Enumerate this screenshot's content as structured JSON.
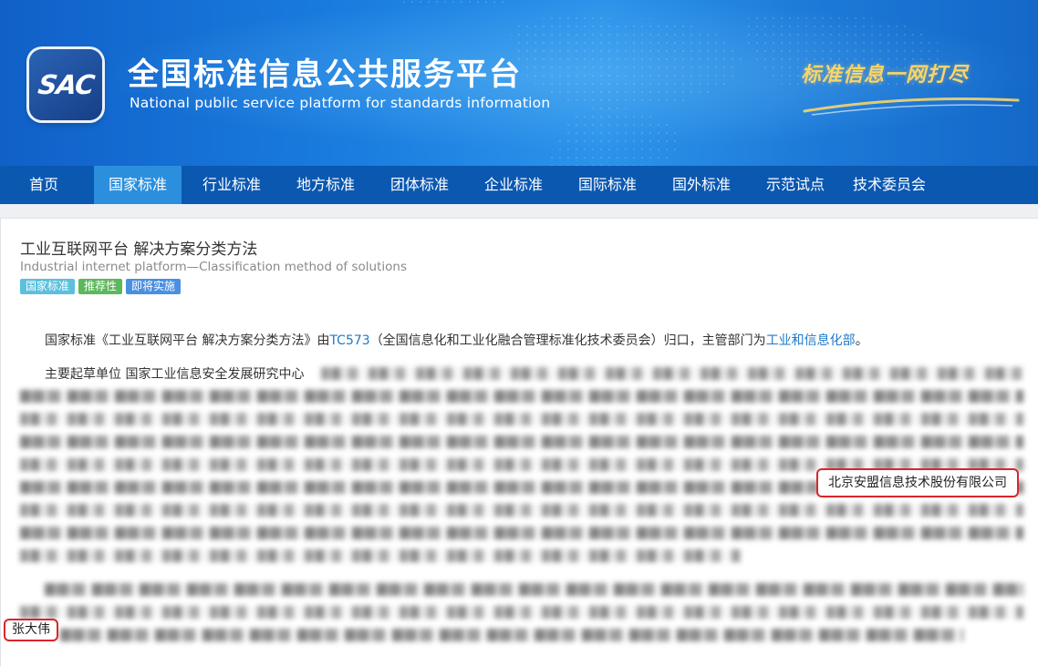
{
  "header": {
    "logo_text": "SAC",
    "title_cn": "全国标准信息公共服务平台",
    "title_en": "National public service platform  for standards information",
    "slogan": "标准信息一网打尽"
  },
  "nav": {
    "items": [
      {
        "label": "首页"
      },
      {
        "label": "国家标准"
      },
      {
        "label": "行业标准"
      },
      {
        "label": "地方标准"
      },
      {
        "label": "团体标准"
      },
      {
        "label": "企业标准"
      },
      {
        "label": "国际标准"
      },
      {
        "label": "国外标准"
      },
      {
        "label": "示范试点"
      },
      {
        "label": "技术委员会"
      }
    ],
    "active": "国家标准"
  },
  "standard": {
    "title": "工业互联网平台 解决方案分类方法",
    "title_en": "Industrial internet platform—Classification method of solutions",
    "badges": [
      {
        "label": "国家标准",
        "color": "#5bc0de"
      },
      {
        "label": "推荐性",
        "color": "#5cb85c"
      },
      {
        "label": "即将实施",
        "color": "#4a90e2"
      }
    ]
  },
  "description": {
    "prefix": "国家标准《工业互联网平台 解决方案分类方法》由",
    "tc_link": "TC573",
    "middle": "（全国信息化和工业化融合管理标准化技术委员会）归口，主管部门为",
    "dept_link": "工业和信息化部",
    "suffix": "。"
  },
  "drafting": {
    "label": "主要起草单位 国家工业信息安全发展研究中心",
    "highlight_unit": "北京安盟信息技术股份有限公司",
    "highlight_person": "张大伟"
  },
  "colors": {
    "nav_bg": "#0b58b1",
    "nav_active": "#2b8fde",
    "link": "#1e78c8",
    "highlight_border": "#d9262c"
  }
}
